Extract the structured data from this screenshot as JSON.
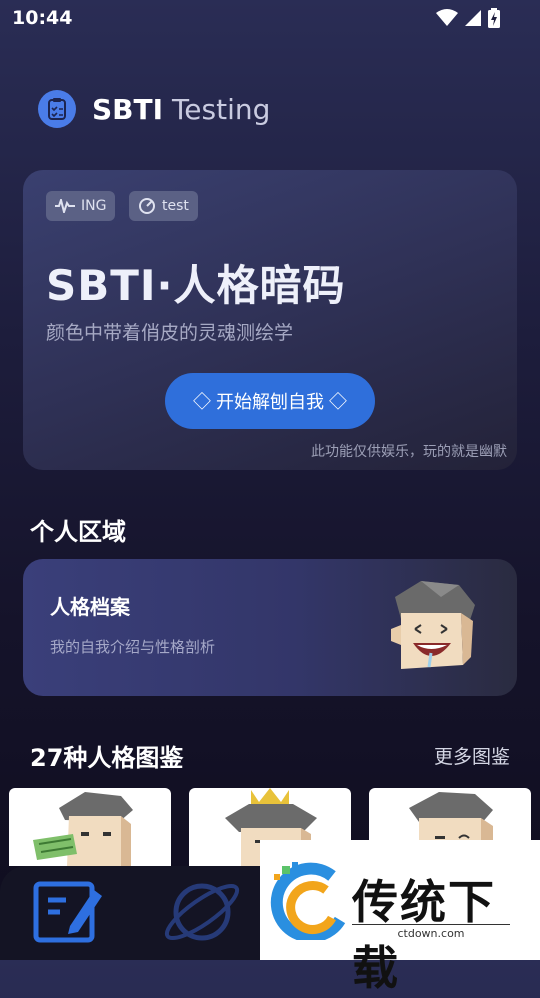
{
  "status_bar": {
    "time": "10:44"
  },
  "header": {
    "brand": "SBTI",
    "title_rest": "Testing"
  },
  "hero": {
    "chips": [
      "ING",
      "test"
    ],
    "title": "SBTI·人格暗码",
    "subtitle": "颜色中带着俏皮的灵魂测绘学",
    "cta": "◇ 开始解刨自我 ◇",
    "note": "此功能仅供娱乐，玩的就是幽默"
  },
  "personal": {
    "section_title": "个人区域",
    "card_title": "人格档案",
    "card_subtitle": "我的自我介绍与性格剖析"
  },
  "gallery": {
    "section_title": "27种人格图鉴",
    "more": "更多图鉴"
  },
  "ad": {
    "name": "传统下载",
    "url": "ctdown.com"
  },
  "colors": {
    "accent": "#2f6fdb",
    "logo": "#4a7ce8",
    "tab_active": "#2e6fe0"
  }
}
